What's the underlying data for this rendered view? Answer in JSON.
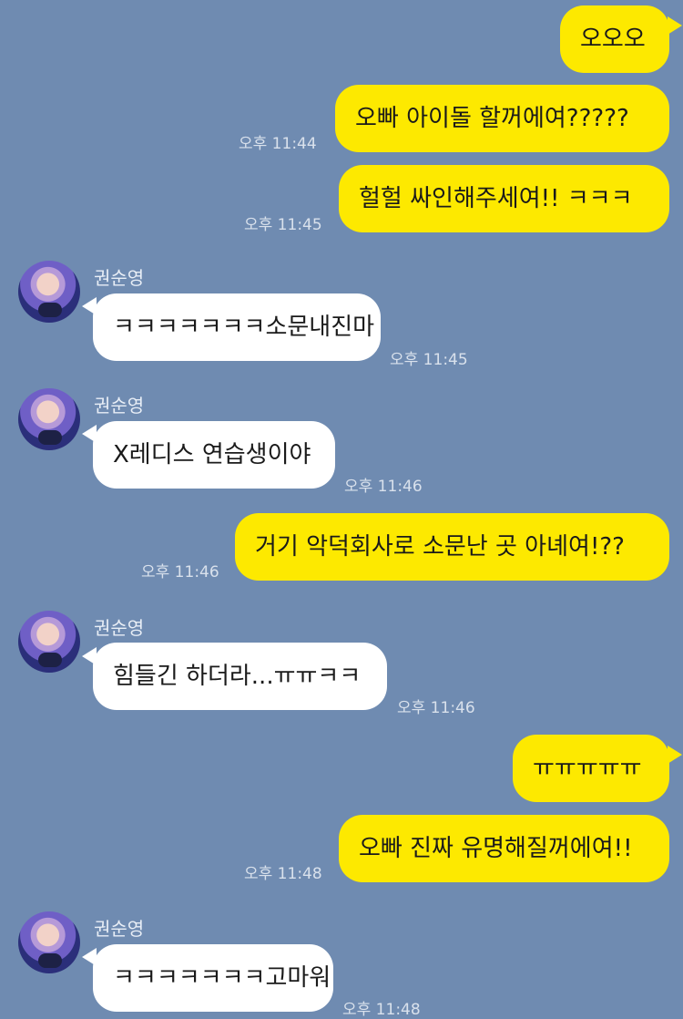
{
  "contact": {
    "name": "권순영"
  },
  "messages": [
    {
      "from": "me",
      "text": "오오오",
      "time": ""
    },
    {
      "from": "me",
      "text": "오빠 아이돌 할꺼에여?????",
      "time": "오후 11:44"
    },
    {
      "from": "me",
      "text": "헐헐 싸인해주세여!! ㅋㅋㅋ",
      "time": "오후 11:45"
    },
    {
      "from": "them",
      "text": "ㅋㅋㅋㅋㅋㅋㅋ소문내진마",
      "time": "오후 11:45"
    },
    {
      "from": "them",
      "text": "X레디스 연습생이야",
      "time": "오후 11:46"
    },
    {
      "from": "me",
      "text": "거기 악덕회사로 소문난 곳 아녜여!??",
      "time": "오후 11:46"
    },
    {
      "from": "them",
      "text": "힘들긴 하더라...ㅠㅠㅋㅋ",
      "time": "오후 11:46"
    },
    {
      "from": "me",
      "text": "ㅠㅠㅠㅠㅠ",
      "time": ""
    },
    {
      "from": "me",
      "text": "오빠 진짜 유명해질꺼에여!!",
      "time": "오후 11:48"
    },
    {
      "from": "them",
      "text": "ㅋㅋㅋㅋㅋㅋㅋ고마워",
      "time": "오후 11:48"
    }
  ],
  "colors": {
    "background": "#6f8bb1",
    "my_bubble": "#fde900",
    "their_bubble": "#ffffff"
  }
}
